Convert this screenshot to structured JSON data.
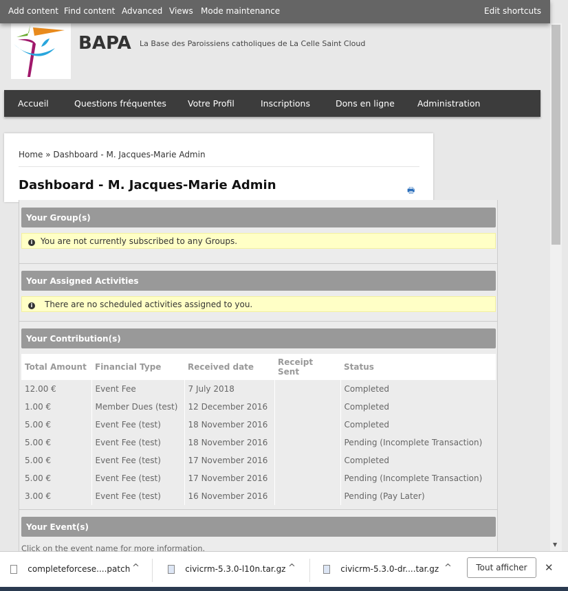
{
  "toolbar": {
    "items": [
      "Add content",
      "Find content",
      "Advanced",
      "Views",
      "Mode maintenance"
    ],
    "shortcuts": "Edit shortcuts"
  },
  "site": {
    "name": "BAPA",
    "slogan": "La Base des Paroissiens catholiques de La Celle Saint Cloud"
  },
  "nav": [
    "Accueil",
    "Questions fréquentes",
    "Votre Profil",
    "Inscriptions",
    "Dons en ligne",
    "Administration"
  ],
  "breadcrumb": {
    "home": "Home",
    "sep": " » ",
    "current": "Dashboard - M. Jacques-Marie Admin"
  },
  "page_title": "Dashboard - M. Jacques-Marie Admin",
  "groups": {
    "title": "Your Group(s)",
    "message": "You are not currently subscribed to any Groups."
  },
  "activities": {
    "title": "Your Assigned Activities",
    "message": "There are no scheduled activities assigned to you."
  },
  "contributions": {
    "title": "Your Contribution(s)",
    "columns": [
      "Total Amount",
      "Financial Type",
      "Received date",
      "Receipt Sent",
      "Status"
    ],
    "rows": [
      [
        "12.00 €",
        "Event Fee",
        "7 July 2018",
        "",
        "Completed"
      ],
      [
        "1.00 €",
        "Member Dues (test)",
        "12 December 2016",
        "",
        "Completed"
      ],
      [
        "5.00 €",
        "Event Fee (test)",
        "18 November 2016",
        "",
        "Completed"
      ],
      [
        "5.00 €",
        "Event Fee (test)",
        "18 November 2016",
        "",
        "Pending (Incomplete Transaction)"
      ],
      [
        "5.00 €",
        "Event Fee (test)",
        "17 November 2016",
        "",
        "Completed"
      ],
      [
        "5.00 €",
        "Event Fee (test)",
        "17 November 2016",
        "",
        "Pending (Incomplete Transaction)"
      ],
      [
        "3.00 €",
        "Event Fee (test)",
        "16 November 2016",
        "",
        "Pending (Pay Later)"
      ]
    ]
  },
  "events": {
    "title": "Your Event(s)",
    "message": "Click on the event name for more information."
  },
  "downloads": {
    "items": [
      "completeforcese....patch",
      "civicrm-5.3.0-l10n.tar.gz",
      "civicrm-5.3.0-dr....tar.gz"
    ],
    "show_all": "Tout afficher"
  }
}
